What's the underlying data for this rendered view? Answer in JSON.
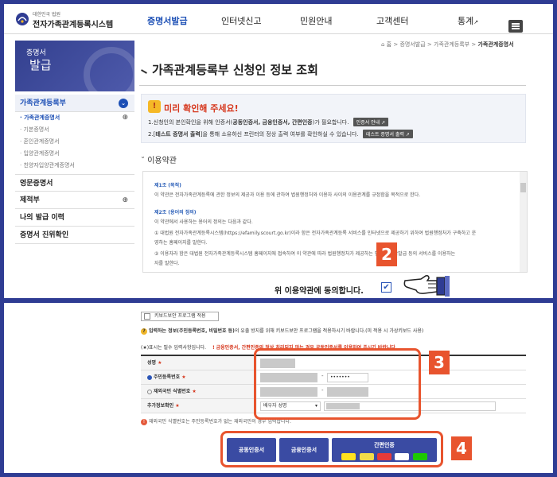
{
  "header": {
    "logo_small": "대한민국 법원",
    "logo_title": "전자가족관계등록시스템",
    "nav": [
      "증명서발급",
      "인터넷신고",
      "민원안내",
      "고객센터",
      "통계"
    ],
    "nav_external_mark": "↗"
  },
  "banner": {
    "line1": "증명서",
    "line2": "발급"
  },
  "sidebar": {
    "group1": "가족관계등록부",
    "items": [
      "· 가족관계증명서",
      "· 기본증명서",
      "· 혼인관계증명서",
      "· 입양관계증명서",
      "· 친양자입양관계증명서"
    ],
    "group2": "영문증명서",
    "group3": "제적부",
    "group4": "나의 발급 이력",
    "group5": "증명서 진위확인",
    "plus": "⊕",
    "chevron": "⌄"
  },
  "breadcrumb": {
    "home": "⌂ 홈",
    "sep": ">",
    "path1": "증명서발급",
    "path2": "가족관계등록부",
    "current": "가족관계증명서"
  },
  "page_title": "가족관계등록부 신청인 정보 조회",
  "notice": {
    "icon_text": "!",
    "head": "미리 확인해 주세요!",
    "line1_a": "1.신청인의 본인확인을 위해 인증서(",
    "line1_b": "공동인증서, 금융인증서, 간편인증",
    "line1_c": ")가 필요합니다.",
    "btn1": "인증서 안내 ↗",
    "line2_a": "2.[",
    "line2_b": "테스트 증명서 출력",
    "line2_c": "]을 통해 소유하신 프린터의 정상 출력 여부를 확인하실 수 있습니다.",
    "btn2": "테스트 증명서 출력 ↗"
  },
  "terms": {
    "section": "이용약관",
    "h1": "제1조 (목적)",
    "p1": "이 약관은 전자가족관계등록에 관한 정보의 제공과 이용 등에 관하여 법원행정처와 이용자 사이의 이용관계를 규정함을 목적으로 한다.",
    "h2": "제2조 (용어의 정의)",
    "p2": "이 약관에서 사용하는 용어의 정의는 다음과 같다.",
    "p3": "① 대법원 전자가족관계등록시스템(https://efamily.scourt.go.kr)이라 함은 전자가족관계등록 서비스를 인터넷으로 제공하기 위하여 법원행정처가 구축하고 운",
    "p4": "영하는 홈페이지를 말한다.",
    "p5": "② 이용자라 함은 대법원 전자가족관계등록시스템 홈페이지에 접속하여 이 약관에 따라 법원행정처가 제공하는 인터넷 열람발급 등의 서비스를 이용하는",
    "p6": "자를 말한다."
  },
  "agree": {
    "label": "위 이용약관에 동의합니다.",
    "check": "✔"
  },
  "badges": {
    "b2": "2",
    "b3": "3",
    "b4": "4"
  },
  "bottom": {
    "keyboard_label": "키보드보안 프로그램 적용",
    "info_icon": "?",
    "info_bold": "입력하는 정보(주민등록번호, 비밀번호 등)",
    "info_rest": "의 유출 방지를 위해 키보드보안 프로그램을 적용하시기 바랍니다.(미 적용 시 가상키보드 사용)",
    "req_note": "(★)표시는 필수 입력사항입니다.",
    "warn_icon": "!",
    "warn_text": "금융인증서, 간편인증의 정상 처리되지 않는 경우 공동인증서를 이용하여 주시기 바랍니다.",
    "form": {
      "name_label": "성명",
      "resident_label": "주민등록번호",
      "foreign_label": "재외국민 식별번호",
      "add_label": "추가정보확인",
      "req_mark": "★",
      "dash": "-",
      "masked": "•••••••",
      "select_value": "배우자 성명",
      "select_arrow": "▾"
    },
    "foot_icon": "!",
    "foot_text": "재외국민 식별번호는 주민등록번호가 없는 재외국민의 경우 입력합니다.",
    "btn_joint": "공동인증서",
    "btn_finance": "금융인증서",
    "btn_simple": "간편인증"
  },
  "colors": {
    "frame": "#2f3c93",
    "accent": "#1c4fb5",
    "highlight": "#e8542e",
    "cert_button": "#3a4ba3"
  }
}
